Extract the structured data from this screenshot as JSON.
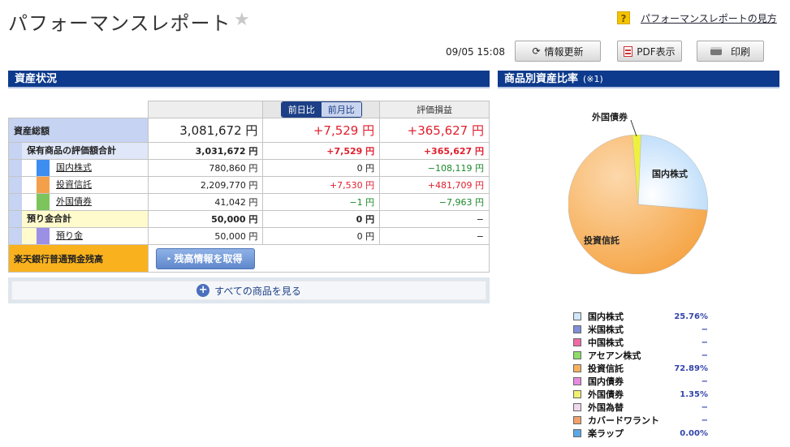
{
  "header": {
    "title": "パフォーマンスレポート",
    "help_link": "パフォーマンスレポートの見方",
    "help_icon": "?",
    "timestamp": "09/05 15:08",
    "refresh_label": "情報更新",
    "pdf_label": "PDF表示",
    "print_label": "印刷"
  },
  "assets": {
    "bar_title": "資産状況",
    "tab_day": "前日比",
    "tab_month": "前月比",
    "col_pl": "評価損益",
    "total": {
      "label": "資産総額",
      "value": "3,081,672 円",
      "change": "+7,529 円",
      "pl": "+365,627 円"
    },
    "holdings": {
      "label": "保有商品の評価額合計",
      "value": "3,031,672 円",
      "change": "+7,529 円",
      "pl": "+365,627 円"
    },
    "rows": [
      {
        "label": "国内株式",
        "value": "780,860 円",
        "change": "0 円",
        "pl": "−108,119 円",
        "color": "#3d8ef0"
      },
      {
        "label": "投資信託",
        "value": "2,209,770 円",
        "change": "+7,530 円",
        "pl": "+481,709 円",
        "color": "#f4a04a"
      },
      {
        "label": "外国債券",
        "value": "41,042 円",
        "change": "−1 円",
        "pl": "−7,963 円",
        "color": "#7cc45c"
      }
    ],
    "deposit_total": {
      "label": "預り金合計",
      "value": "50,000 円",
      "change": "0 円",
      "pl": "−"
    },
    "deposit_row": {
      "label": "預り金",
      "value": "50,000 円",
      "change": "0 円",
      "pl": "−",
      "color": "#9c8fe6"
    },
    "bank": {
      "label": "楽天銀行普通預金残高",
      "button": "残高情報を取得"
    },
    "see_all": "すべての商品を見る"
  },
  "ratio": {
    "bar_title": "商品別資産比率",
    "note": "(※1)",
    "pie_labels": {
      "domestic": "国内株式",
      "fund": "投資信託",
      "bond": "外国債券"
    },
    "legend": [
      {
        "name": "国内株式",
        "pct": "25.76%",
        "color": "#cfe6fb"
      },
      {
        "name": "米国株式",
        "pct": "−",
        "color": "#7f8fd8"
      },
      {
        "name": "中国株式",
        "pct": "−",
        "color": "#f06aa6"
      },
      {
        "name": "アセアン株式",
        "pct": "−",
        "color": "#8edc6a"
      },
      {
        "name": "投資信託",
        "pct": "72.89%",
        "color": "#f7b15c"
      },
      {
        "name": "国内債券",
        "pct": "−",
        "color": "#e88ae0"
      },
      {
        "name": "外国債券",
        "pct": "1.35%",
        "color": "#eef070"
      },
      {
        "name": "外国為替",
        "pct": "−",
        "color": "#eed8ec"
      },
      {
        "name": "カバードワラント",
        "pct": "−",
        "color": "#f4a06a"
      },
      {
        "name": "楽ラップ",
        "pct": "0.00%",
        "color": "#5aa8e8"
      }
    ]
  }
}
